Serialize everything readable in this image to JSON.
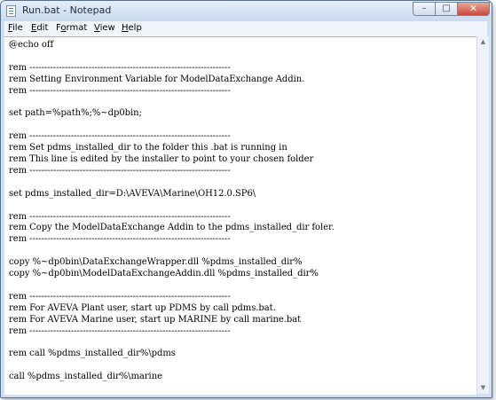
{
  "window": {
    "title": "Run.bat - Notepad",
    "min_symbol": "–",
    "max_symbol": "□",
    "close_symbol": "✕"
  },
  "menu": [
    {
      "accel": "F",
      "rest": "ile"
    },
    {
      "accel": "E",
      "rest": "dit"
    },
    {
      "lead": "F",
      "accel": "o",
      "rest": "rmat"
    },
    {
      "accel": "V",
      "rest": "iew"
    },
    {
      "accel": "H",
      "rest": "elp"
    }
  ],
  "scrollbar": {
    "up_symbol": "▲",
    "down_symbol": "▼"
  },
  "document": {
    "lines": [
      "@echo off",
      "",
      "rem --------------------------------------------------------------------",
      "rem Setting Environment Variable for ModelDataExchange Addin.",
      "rem --------------------------------------------------------------------",
      "",
      "set path=%path%;%~dp0bin;",
      "",
      "rem --------------------------------------------------------------------",
      "rem Set pdms_installed_dir to the folder this .bat is running in",
      "rem This line is edited by the installer to point to your chosen folder",
      "rem --------------------------------------------------------------------",
      "",
      "set pdms_installed_dir=D:\\AVEVA\\Marine\\OH12.0.SP6\\",
      "",
      "rem --------------------------------------------------------------------",
      "rem Copy the ModelDataExchange Addin to the pdms_installed_dir foler.",
      "rem --------------------------------------------------------------------",
      "",
      "copy %~dp0bin\\DataExchangeWrapper.dll %pdms_installed_dir%",
      "copy %~dp0bin\\ModelDataExchangeAddin.dll %pdms_installed_dir%",
      "",
      "rem --------------------------------------------------------------------",
      "rem For AVEVA Plant user, start up PDMS by call pdms.bat.",
      "rem For AVEVA Marine user, start up MARINE by call marine.bat",
      "rem --------------------------------------------------------------------",
      "",
      "rem call %pdms_installed_dir%\\pdms",
      "",
      "call %pdms_installed_dir%\\marine"
    ]
  }
}
